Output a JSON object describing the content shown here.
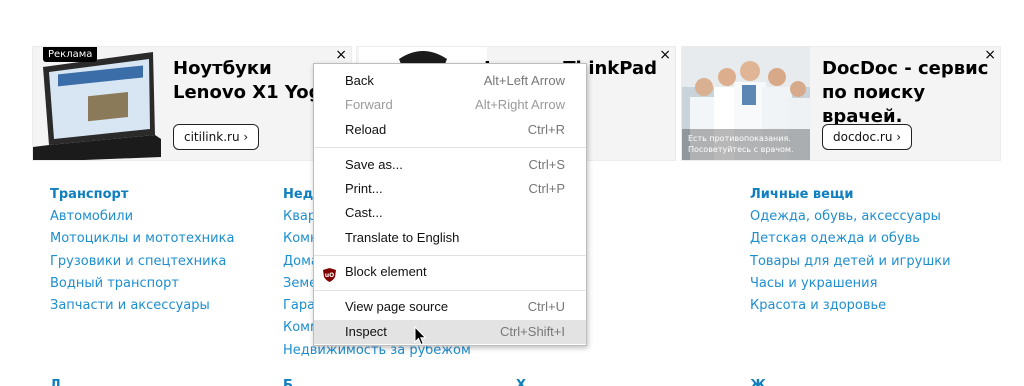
{
  "ads": [
    {
      "badge": "Реклама",
      "title": "Ноутбуки\nLenovo X1 Yoga",
      "cta": "citilink.ru ›",
      "close": "×"
    },
    {
      "title": "Lenovo ThinkPad",
      "close": "×"
    },
    {
      "title": "DocDoc - сервис\nпо поиску врачей.",
      "cta": "docdoc.ru ›",
      "caption": "Есть противопоказания. Посоветуйтесь с врачом.",
      "close": "×"
    }
  ],
  "categories": [
    {
      "heading": "Транспорт",
      "links": [
        "Автомобили",
        "Мотоциклы и мототехника",
        "Грузовики и спецтехника",
        "Водный транспорт",
        "Запчасти и аксессуары"
      ]
    },
    {
      "heading": "Недв",
      "links": [
        "Кварт",
        "Комн",
        "Дома",
        "Земе",
        "Гараж",
        "Комм",
        "Недвижимость за рубежом"
      ]
    },
    {
      "heading": "Личные вещи",
      "links": [
        "Одежда, обувь, аксессуары",
        "Детская одежда и обувь",
        "Товары для детей и игрушки",
        "Часы и украшения",
        "Красота и здоровье"
      ]
    }
  ],
  "next_row_headings": [
    "Д",
    "Б",
    "Х",
    "Ж"
  ],
  "context_menu": {
    "items": [
      {
        "label": "Back",
        "shortcut": "Alt+Left Arrow"
      },
      {
        "label": "Forward",
        "shortcut": "Alt+Right Arrow",
        "disabled": true
      },
      {
        "label": "Reload",
        "shortcut": "Ctrl+R"
      },
      {
        "label": "Save as...",
        "shortcut": "Ctrl+S"
      },
      {
        "label": "Print...",
        "shortcut": "Ctrl+P"
      },
      {
        "label": "Cast...",
        "shortcut": ""
      },
      {
        "label": "Translate to English",
        "shortcut": ""
      },
      {
        "label": "Block element",
        "shortcut": "",
        "icon": "ublock-origin-icon"
      },
      {
        "label": "View page source",
        "shortcut": "Ctrl+U"
      },
      {
        "label": "Inspect",
        "shortcut": "Ctrl+Shift+I",
        "hovered": true
      }
    ]
  },
  "colors": {
    "link": "#1e8ecf",
    "heading": "#0f7fbf",
    "menu_hover": "#e3e3e3",
    "ublock": "#800000"
  }
}
